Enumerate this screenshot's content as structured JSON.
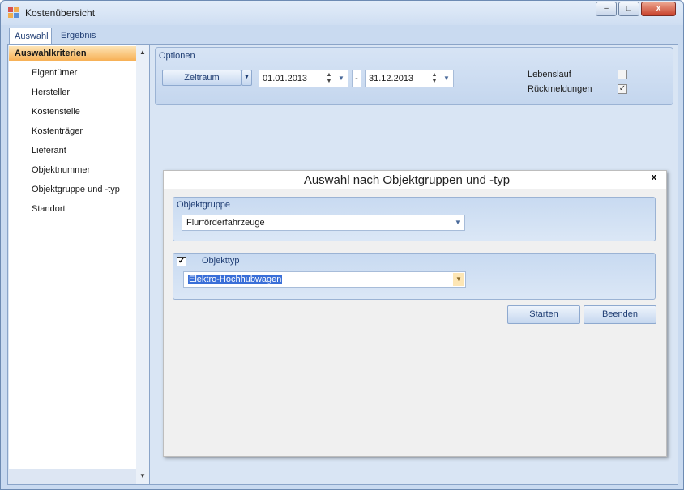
{
  "window": {
    "title": "Kostenübersicht",
    "controls": {
      "minimize": "–",
      "maximize": "□",
      "close": "x"
    }
  },
  "tabs": [
    "Auswahl",
    "Ergebnis"
  ],
  "sidebar": {
    "header": "Auswahlkriterien",
    "items": [
      "Eigentümer",
      "Hersteller",
      "Kostenstelle",
      "Kostenträger",
      "Lieferant",
      "Objektnummer",
      "Objektgruppe und -typ",
      "Standort"
    ]
  },
  "options": {
    "title": "Optionen",
    "period_button": "Zeitraum",
    "date_from": "01.01.2013",
    "date_separator": "-",
    "date_to": "31.12.2013",
    "checkboxes": [
      {
        "label": "Lebenslauf",
        "checked": false
      },
      {
        "label": "Rückmeldungen",
        "checked": true
      }
    ]
  },
  "dialog": {
    "title": "Auswahl nach Objektgruppen und -typ",
    "close": "x",
    "group_label": "Objektgruppe",
    "group_value": "Flurförderfahrzeuge",
    "type_label": "Objekttyp",
    "type_checked": true,
    "type_value": "Elektro-Hochhubwagen",
    "start_button": "Starten",
    "end_button": "Beenden"
  },
  "colors": {
    "accent_orange": "#f7b055",
    "panel_blue": "#c9daf0",
    "selection_blue": "#3a6fd8"
  }
}
